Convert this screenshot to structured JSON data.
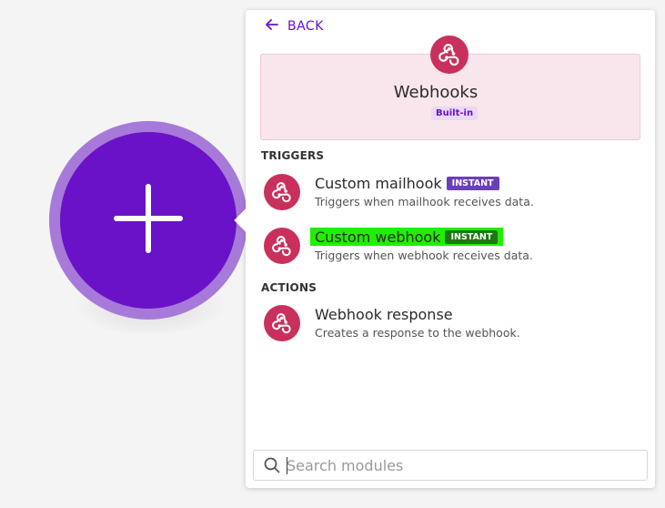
{
  "colors": {
    "accent": "#6a12c7",
    "add_circle_ring": "#a77ad9",
    "webhook_brand": "#c9305c",
    "app_card_bg": "#f9e6ec",
    "instant_badge": "#6b3fb7",
    "highlight": "#22ee00"
  },
  "canvas": {
    "add_icon": "plus-icon"
  },
  "panel": {
    "back_label": "BACK",
    "back_icon": "arrow-left-icon",
    "app": {
      "name": "Webhooks",
      "badge": "Built-in",
      "icon": "webhook-icon"
    },
    "sections": {
      "triggers_title": "TRIGGERS",
      "actions_title": "ACTIONS"
    },
    "triggers": [
      {
        "name": "Custom mailhook",
        "badge": "INSTANT",
        "description": "Triggers when mailhook receives data.",
        "icon": "webhook-icon"
      },
      {
        "name": "Custom webhook",
        "badge": "INSTANT",
        "description": "Triggers when webhook receives data.",
        "icon": "webhook-icon",
        "highlighted": true
      }
    ],
    "actions": [
      {
        "name": "Webhook response",
        "description": "Creates a response to the webhook.",
        "icon": "webhook-icon"
      }
    ],
    "search": {
      "placeholder": "Search modules",
      "value": "",
      "icon": "search-icon"
    }
  }
}
